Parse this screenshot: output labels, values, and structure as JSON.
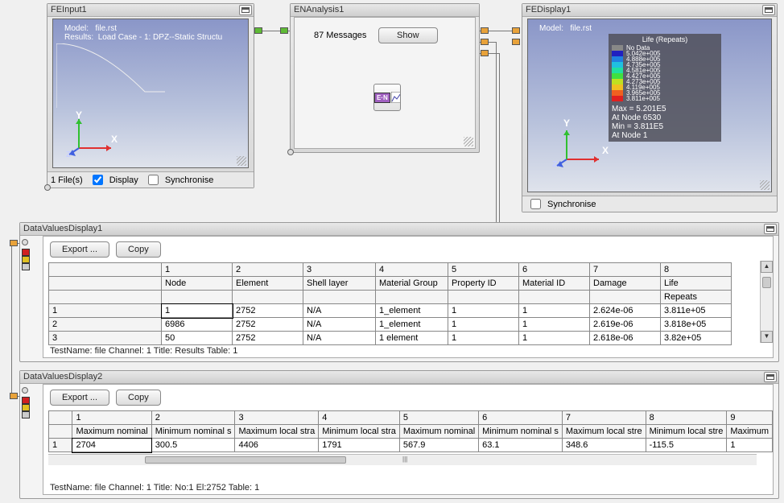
{
  "feinput": {
    "title": "FEInput1",
    "model_label": "Model:",
    "model": "file.rst",
    "results_label": "Results:",
    "results": "Load Case - 1: DPZ--Static Structu",
    "files": "1 File(s)",
    "display_label": "Display",
    "sync_label": "Synchronise",
    "display_checked": true,
    "sync_checked": false
  },
  "enanalysis": {
    "title": "ENAnalysis1",
    "messages": "87 Messages",
    "show": "Show",
    "icon_text": "E·N"
  },
  "fedisplay": {
    "title": "FEDisplay1",
    "model_label": "Model:",
    "model": "file.rst",
    "legend_title": "Life (Repeats)",
    "legend_nodata": "No Data",
    "legend_values": [
      "5.042e+005",
      "4.888e+005",
      "4.735e+005",
      "4.581e+005",
      "4.427e+005",
      "4.273e+005",
      "4.119e+005",
      "3.965e+005",
      "3.811e+005"
    ],
    "max": "Max = 5.201E5",
    "max_node": "At Node 6530",
    "min": "Min = 3.811E5",
    "min_node": "At Node 1",
    "sync_label": "Synchronise",
    "sync_checked": false
  },
  "dvd1": {
    "title": "DataValuesDisplay1",
    "export": "Export ...",
    "copy": "Copy",
    "col_nums": [
      "1",
      "2",
      "3",
      "4",
      "5",
      "6",
      "7",
      "8"
    ],
    "headers": [
      "Node",
      "Element",
      "Shell layer",
      "Material Group",
      "Property ID",
      "Material ID",
      "Damage",
      "Life"
    ],
    "header3": [
      "",
      "",
      "",
      "",
      "",
      "",
      "",
      "Repeats"
    ],
    "rows": [
      {
        "n": "1",
        "c": [
          "1",
          "2752",
          "N/A",
          "1_element",
          "1",
          "1",
          "2.624e-06",
          "3.811e+05"
        ]
      },
      {
        "n": "2",
        "c": [
          "6986",
          "2752",
          "N/A",
          "1_element",
          "1",
          "1",
          "2.619e-06",
          "3.818e+05"
        ]
      },
      {
        "n": "3",
        "c": [
          "50",
          "2752",
          "N/A",
          "1 element",
          "1",
          "1",
          "2.618e-06",
          "3.82e+05"
        ]
      }
    ],
    "status": "TestName: file Channel: 1 Title: Results Table: 1"
  },
  "dvd2": {
    "title": "DataValuesDisplay2",
    "export": "Export ...",
    "copy": "Copy",
    "col_nums": [
      "1",
      "2",
      "3",
      "4",
      "5",
      "6",
      "7",
      "8",
      "9"
    ],
    "headers": [
      "Maximum nominal",
      "Minimum nominal s",
      "Maximum local stra",
      "Minimum local stra",
      "Maximum nominal",
      "Minimum nominal s",
      "Maximum local stre",
      "Minimum local stre",
      "Maximum"
    ],
    "rows": [
      {
        "n": "1",
        "c": [
          "2704",
          "300.5",
          "4406",
          "1791",
          "567.9",
          "63.1",
          "348.6",
          "-115.5",
          "1"
        ]
      }
    ],
    "status": "TestName: file Channel: 1 Title: No:1 El:2752 Table: 1"
  }
}
